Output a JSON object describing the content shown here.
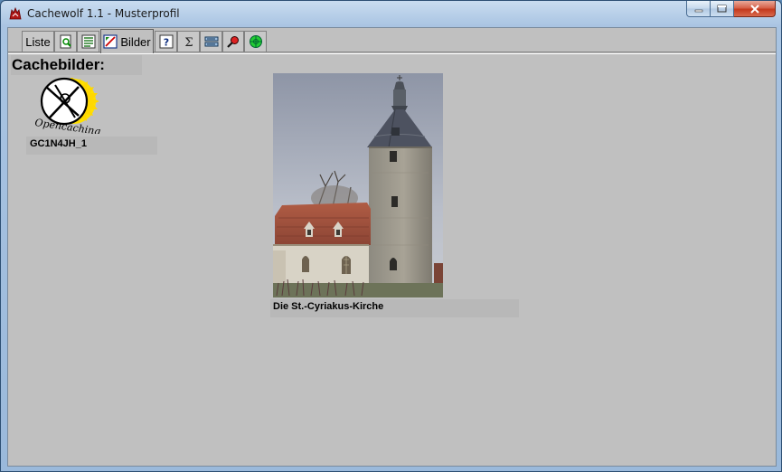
{
  "window": {
    "title": "Cachewolf 1.1 - Musterprofil"
  },
  "tabs": [
    {
      "label": "Liste",
      "icon": "list-tab"
    },
    {
      "label": "",
      "icon": "details-icon"
    },
    {
      "label": "",
      "icon": "description-icon"
    },
    {
      "label": "Bilder",
      "icon": "pictures-icon"
    },
    {
      "label": "",
      "icon": "hints-icon"
    },
    {
      "label": "",
      "icon": "calculator-icon"
    },
    {
      "label": "",
      "icon": "notes-icon"
    },
    {
      "label": "",
      "icon": "search-icon"
    },
    {
      "label": "",
      "icon": "goto-icon"
    }
  ],
  "content": {
    "section_title": "Cachebilder:",
    "images": [
      {
        "caption": "GC1N4JH_1",
        "kind": "opencaching-logo",
        "logo_text": "Opencaching"
      },
      {
        "caption": "Die St.-Cyriakus-Kirche",
        "kind": "church-photo"
      }
    ]
  },
  "colors": {
    "client_bg": "#c0c0c0",
    "frame_blue": "#a9c4e2",
    "close_red": "#c4391d"
  }
}
